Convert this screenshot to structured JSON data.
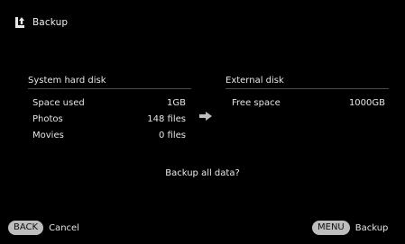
{
  "header": {
    "title": "Backup",
    "icon": "backup-icon"
  },
  "left_panel": {
    "title": "System hard disk",
    "rows": [
      {
        "label": "Space used",
        "value": "1GB"
      },
      {
        "label": "Photos",
        "value": "148 files"
      },
      {
        "label": "Movies",
        "value": "0 files"
      }
    ]
  },
  "right_panel": {
    "title": "External disk",
    "rows": [
      {
        "label": "Free space",
        "value": "1000GB"
      }
    ]
  },
  "arrow_icon": "arrow-right-icon",
  "question": "Backup all data?",
  "footer": {
    "back": {
      "key": "BACK",
      "label": "Cancel"
    },
    "menu": {
      "key": "MENU",
      "label": "Backup"
    }
  },
  "colors": {
    "background": "#000000",
    "text": "#e6e6e6",
    "pill": "#bdbdbd",
    "rule": "#4a4a4a"
  }
}
